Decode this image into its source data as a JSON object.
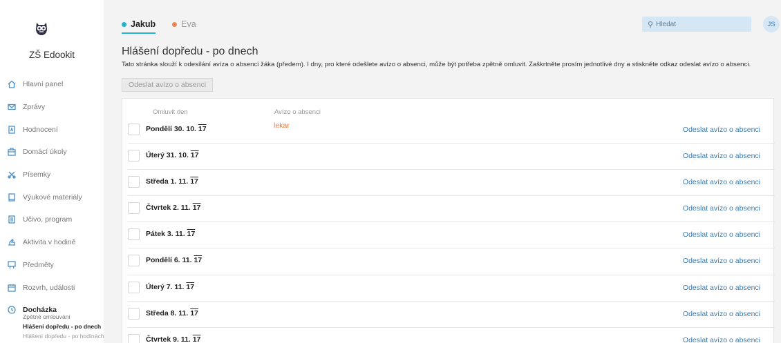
{
  "sidebar": {
    "logo": "owl-logo",
    "school_name": "ZŠ Edookit",
    "items": [
      {
        "label": "Hlavní panel",
        "icon": "home-icon"
      },
      {
        "label": "Zprávy",
        "icon": "mail-icon"
      },
      {
        "label": "Hodnocení",
        "icon": "grade-icon"
      },
      {
        "label": "Domácí úkoly",
        "icon": "homework-icon"
      },
      {
        "label": "Písemky",
        "icon": "tools-icon"
      },
      {
        "label": "Výukové materiály",
        "icon": "book-icon"
      },
      {
        "label": "Učivo, program",
        "icon": "document-icon"
      },
      {
        "label": "Aktivita v hodině",
        "icon": "hand-icon"
      },
      {
        "label": "Předměty",
        "icon": "subjects-icon"
      },
      {
        "label": "Rozvrh, události",
        "icon": "calendar-icon"
      },
      {
        "label": "Docházka",
        "icon": "clock-icon"
      }
    ],
    "subitems": [
      "Zpětné omlouvání",
      "Hlášení dopředu - po dnech",
      "Hlášení dopředu - po hodinách"
    ]
  },
  "header": {
    "tabs": [
      {
        "label": "Jakub",
        "color": "#27b0c9"
      },
      {
        "label": "Eva",
        "color": "#e98a56"
      }
    ],
    "search_placeholder": "Hledat",
    "avatar_initials": "JS"
  },
  "main": {
    "title": "Hlášení dopředu - po dnech",
    "description": "Tato stránka slouží k odesílání avíza o absenci žáka (předem). I dny, pro které odešlete avízo o absenci, může být potřeba zpětně omluvit. Zaškrtněte prosím jednotlivé dny a stiskněte odkaz odeslat avízo o absenci.",
    "submit_button": "Odeslat avízo o absenci",
    "col_day": "Omluvit den",
    "col_note": "Avízo o absenci",
    "action_label": "Odeslat avízo o absenci",
    "rows": [
      {
        "day": "Pondělí 30. 10. ",
        "yr": "17",
        "note": "lekar"
      },
      {
        "day": "Úterý 31. 10. ",
        "yr": "17",
        "note": ""
      },
      {
        "day": "Středa 1. 11. ",
        "yr": "17",
        "note": ""
      },
      {
        "day": "Čtvrtek 2. 11. ",
        "yr": "17",
        "note": ""
      },
      {
        "day": "Pátek 3. 11. ",
        "yr": "17",
        "note": ""
      },
      {
        "day": "Pondělí 6. 11. ",
        "yr": "17",
        "note": ""
      },
      {
        "day": "Úterý 7. 11. ",
        "yr": "17",
        "note": ""
      },
      {
        "day": "Středa 8. 11. ",
        "yr": "17",
        "note": ""
      },
      {
        "day": "Čtvrtek 9. 11. ",
        "yr": "17",
        "note": ""
      }
    ]
  }
}
